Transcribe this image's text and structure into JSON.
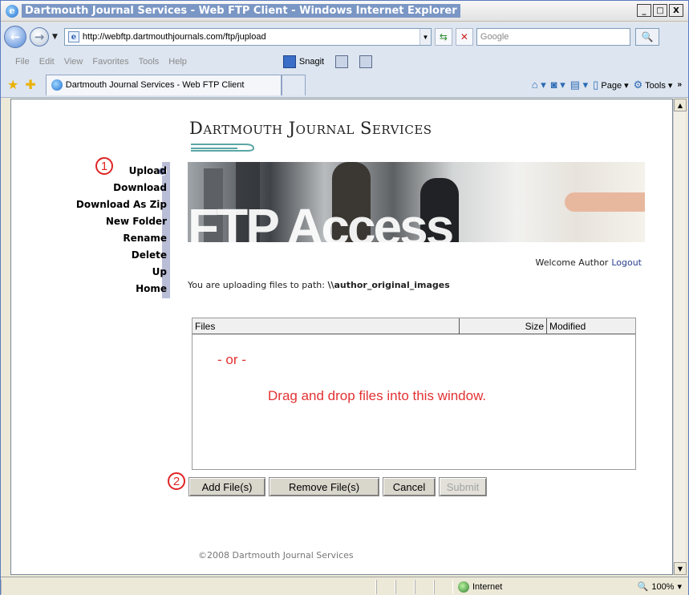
{
  "window": {
    "title": "Dartmouth Journal Services - Web FTP Client - Windows Internet Explorer",
    "min": "_",
    "max": "□",
    "close": "X"
  },
  "address": {
    "url": "http://webftp.dartmouthjournals.com/ftp/jupload",
    "search_placeholder": "Google"
  },
  "menu": [
    "File",
    "Edit",
    "View",
    "Favorites",
    "Tools",
    "Help"
  ],
  "snagit_label": "Snagit",
  "tab": {
    "title": "Dartmouth Journal Services - Web FTP Client"
  },
  "command_bar": {
    "page": "Page",
    "tools": "Tools"
  },
  "page": {
    "logo": "Dartmouth Journal Services",
    "banner_title": "FTP Access",
    "sidebar": [
      "Upload",
      "Download",
      "Download As Zip",
      "New Folder",
      "Rename",
      "Delete",
      "Up",
      "Home"
    ],
    "welcome": "Welcome Author",
    "logout": "Logout",
    "path_prefix": "You are uploading files to path:",
    "path": "\\\\author_original_images",
    "file_columns": {
      "files": "Files",
      "size": "Size",
      "modified": "Modified"
    },
    "or_text": "- or -",
    "drag_text": "Drag and drop files into this window.",
    "buttons": {
      "add": "Add File(s)",
      "remove": "Remove File(s)",
      "cancel": "Cancel",
      "submit": "Submit"
    },
    "step1": "1",
    "step2": "2",
    "copyright": "©2008 Dartmouth Journal Services"
  },
  "status": {
    "zone": "Internet",
    "zoom": "100%"
  },
  "colors": {
    "annotation_red": "#e02424",
    "drag_text_red": "#e33232",
    "sidebar_rail": "#b9bdd6"
  }
}
